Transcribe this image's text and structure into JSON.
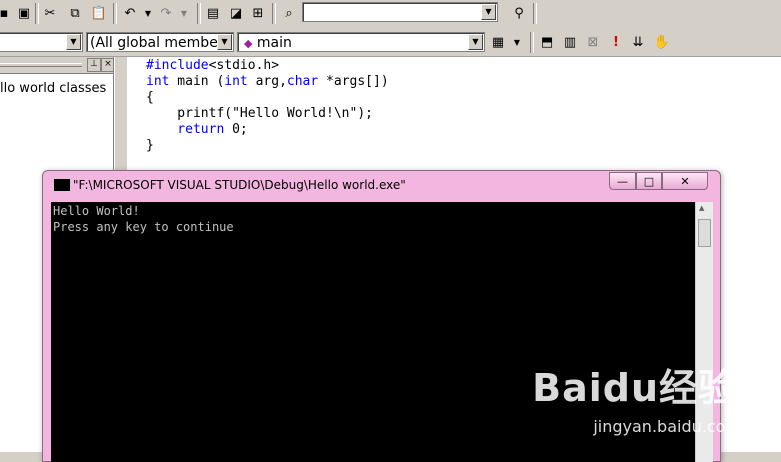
{
  "toolbar1": {
    "right_combo_value": ""
  },
  "toolbar2": {
    "class_combo": "",
    "members_combo": "(All global members",
    "function_combo": "main"
  },
  "leftpane": {
    "tree_label": "llo world classes"
  },
  "editor": {
    "lines": [
      {
        "kw": "#include",
        "rest": "<stdio.h>"
      },
      {
        "kw": "int",
        "rest": " main (",
        "kw2": "int",
        "rest2": " arg,",
        "kw3": "char",
        "rest3": " *args[])"
      },
      {
        "plain": "{"
      },
      {
        "plain": "    printf(\"Hello World!\\n\");"
      },
      {
        "kw": "    return",
        "rest": " 0;"
      },
      {
        "plain": "}"
      }
    ]
  },
  "console": {
    "title": "\"F:\\MICROSOFT VISUAL STUDIO\\Debug\\Hello world.exe\"",
    "minimize": "—",
    "restore": "□",
    "close": "✕",
    "output": [
      "Hello World!",
      "Press any key to continue"
    ]
  },
  "watermark": {
    "brand": "Baidu经验",
    "url": "jingyan.baidu.com"
  }
}
